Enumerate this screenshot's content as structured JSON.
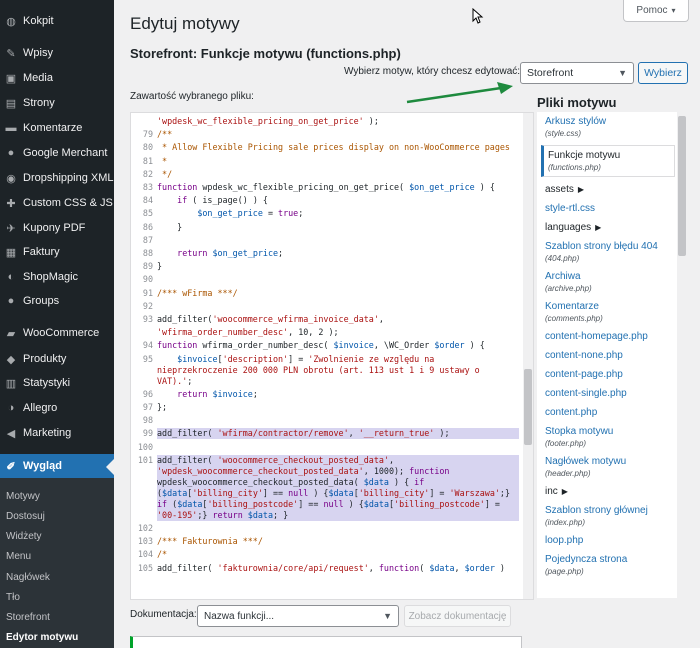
{
  "sidebar": {
    "items": [
      {
        "label": "Kokpit",
        "icon": "dashboard-icon",
        "glyph": "◍"
      },
      {
        "label": "Wpisy",
        "icon": "pin-icon",
        "glyph": "✎"
      },
      {
        "label": "Media",
        "icon": "media-icon",
        "glyph": "▣"
      },
      {
        "label": "Strony",
        "icon": "pages-icon",
        "glyph": "▤"
      },
      {
        "label": "Komentarze",
        "icon": "comments-icon",
        "glyph": "▬"
      },
      {
        "label": "Google Merchant",
        "icon": "google-merchant-icon",
        "glyph": "●"
      },
      {
        "label": "Dropshipping XML",
        "icon": "dropshipping-icon",
        "glyph": "◉"
      },
      {
        "label": "Custom CSS & JS",
        "icon": "custom-css-icon",
        "glyph": "✚"
      },
      {
        "label": "Kupony PDF",
        "icon": "coupon-icon",
        "glyph": "✈"
      },
      {
        "label": "Faktury",
        "icon": "invoices-icon",
        "glyph": "▦"
      },
      {
        "label": "ShopMagic",
        "icon": "shopmagic-icon",
        "glyph": "◐"
      },
      {
        "label": "Groups",
        "icon": "groups-icon",
        "glyph": "●"
      },
      {
        "label": "WooCommerce",
        "icon": "woocommerce-icon",
        "glyph": "▰"
      },
      {
        "label": "Produkty",
        "icon": "products-icon",
        "glyph": "◆"
      },
      {
        "label": "Statystyki",
        "icon": "stats-icon",
        "glyph": "▥"
      },
      {
        "label": "Allegro",
        "icon": "allegro-icon",
        "glyph": "◑"
      },
      {
        "label": "Marketing",
        "icon": "marketing-icon",
        "glyph": "◀"
      },
      {
        "label": "Wygląd",
        "icon": "appearance-icon",
        "glyph": "✐"
      }
    ],
    "submenu": [
      {
        "label": "Motywy"
      },
      {
        "label": "Dostosuj"
      },
      {
        "label": "Widżety"
      },
      {
        "label": "Menu"
      },
      {
        "label": "Nagłówek"
      },
      {
        "label": "Tło"
      },
      {
        "label": "Storefront"
      },
      {
        "label": "Edytor motywu"
      }
    ]
  },
  "header": {
    "title": "Edytuj motywy",
    "help_label": "Pomoc",
    "file_title": "Storefront: Funkcje motywu (functions.php)",
    "select_label": "Wybierz motyw, który chcesz edytować:",
    "selected_theme": "Storefront",
    "select_button": "Wybierz",
    "content_label": "Zawartość wybranego pliku:",
    "files_title": "Pliki motywu"
  },
  "code": {
    "lines": [
      {
        "n": "",
        "tokens": [
          [
            "s",
            "'wpdesk_wc_flexible_pricing_on_get_price'"
          ],
          [
            "d",
            " );"
          ]
        ]
      },
      {
        "n": "79",
        "tokens": [
          [
            "c",
            "/**"
          ]
        ]
      },
      {
        "n": "80",
        "tokens": [
          [
            "c",
            " * Allow Flexible Pricing sale prices display on non-WooCommerce pages"
          ]
        ]
      },
      {
        "n": "81",
        "tokens": [
          [
            "c",
            " *"
          ]
        ]
      },
      {
        "n": "82",
        "tokens": [
          [
            "c",
            " */"
          ]
        ]
      },
      {
        "n": "83",
        "tokens": [
          [
            "k",
            "function"
          ],
          [
            "d",
            " wpdesk_wc_flexible_pricing_on_get_price( "
          ],
          [
            "v",
            "$on_get_price"
          ],
          [
            "d",
            " ) {"
          ]
        ]
      },
      {
        "n": "84",
        "tokens": [
          [
            "d",
            "    "
          ],
          [
            "k",
            "if"
          ],
          [
            "d",
            " ( is_page() ) {"
          ]
        ]
      },
      {
        "n": "85",
        "tokens": [
          [
            "d",
            "        "
          ],
          [
            "v",
            "$on_get_price"
          ],
          [
            "d",
            " = "
          ],
          [
            "k",
            "true"
          ],
          [
            "d",
            ";"
          ]
        ]
      },
      {
        "n": "86",
        "tokens": [
          [
            "d",
            "    }"
          ]
        ]
      },
      {
        "n": "87",
        "tokens": [
          [
            "d",
            ""
          ]
        ]
      },
      {
        "n": "88",
        "tokens": [
          [
            "d",
            "    "
          ],
          [
            "k",
            "return"
          ],
          [
            "d",
            " "
          ],
          [
            "v",
            "$on_get_price"
          ],
          [
            "d",
            ";"
          ]
        ]
      },
      {
        "n": "89",
        "tokens": [
          [
            "d",
            "}"
          ]
        ]
      },
      {
        "n": "90",
        "tokens": [
          [
            "d",
            ""
          ]
        ]
      },
      {
        "n": "91",
        "tokens": [
          [
            "c",
            "/*** wFirma ***/"
          ]
        ]
      },
      {
        "n": "92",
        "tokens": [
          [
            "d",
            ""
          ]
        ]
      },
      {
        "n": "93",
        "tokens": [
          [
            "d",
            "add_filter("
          ],
          [
            "s",
            "'woocommerce_wfirma_invoice_data'"
          ],
          [
            "d",
            ","
          ]
        ]
      },
      {
        "n": "",
        "tokens": [
          [
            "s",
            "'wfirma_order_number_desc'"
          ],
          [
            "d",
            ", 10, 2 );"
          ]
        ]
      },
      {
        "n": "94",
        "tokens": [
          [
            "k",
            "function"
          ],
          [
            "d",
            " wfirma_order_number_desc( "
          ],
          [
            "v",
            "$invoice"
          ],
          [
            "d",
            ", \\WC_Order "
          ],
          [
            "v",
            "$order"
          ],
          [
            "d",
            " ) {"
          ]
        ]
      },
      {
        "n": "95",
        "tokens": [
          [
            "d",
            "    "
          ],
          [
            "v",
            "$invoice"
          ],
          [
            "d",
            "["
          ],
          [
            "s",
            "'description'"
          ],
          [
            "d",
            "] = "
          ],
          [
            "s",
            "'Zwolnienie ze względu na nieprzekroczenie 200 000 PLN obrotu (art. 113 ust 1 i 9 ustawy o VAT).'"
          ],
          [
            "d",
            ";"
          ]
        ]
      },
      {
        "n": "96",
        "tokens": [
          [
            "d",
            "    "
          ],
          [
            "k",
            "return"
          ],
          [
            "d",
            " "
          ],
          [
            "v",
            "$invoice"
          ],
          [
            "d",
            ";"
          ]
        ]
      },
      {
        "n": "97",
        "tokens": [
          [
            "d",
            "};"
          ]
        ]
      },
      {
        "n": "98",
        "tokens": [
          [
            "d",
            ""
          ]
        ]
      },
      {
        "n": "99",
        "hl": true,
        "tokens": [
          [
            "d",
            "add_filter( "
          ],
          [
            "s",
            "'wfirma/contractor/remove'"
          ],
          [
            "d",
            ", "
          ],
          [
            "s",
            "'__return_true'"
          ],
          [
            "d",
            " );"
          ]
        ]
      },
      {
        "n": "100",
        "hl": true,
        "tokens": [
          [
            "d",
            ""
          ]
        ]
      },
      {
        "n": "101",
        "hl": true,
        "tokens": [
          [
            "d",
            "add_filter( "
          ],
          [
            "s",
            "'woocommerce_checkout_posted_data'"
          ],
          [
            "d",
            ", "
          ],
          [
            "s",
            "'wpdesk_woocommerce_checkout_posted_data'"
          ],
          [
            "d",
            ", 1000); "
          ],
          [
            "k",
            "function"
          ],
          [
            "d",
            " wpdesk_woocommerce_checkout_posted_data( "
          ],
          [
            "v",
            "$data"
          ],
          [
            "d",
            " ) { "
          ],
          [
            "k",
            "if"
          ],
          [
            "d",
            " ("
          ],
          [
            "v",
            "$data"
          ],
          [
            "d",
            "["
          ],
          [
            "s",
            "'billing_city'"
          ],
          [
            "d",
            "] == "
          ],
          [
            "k",
            "null"
          ],
          [
            "d",
            " ) {"
          ],
          [
            "v",
            "$data"
          ],
          [
            "d",
            "["
          ],
          [
            "s",
            "'billing_city'"
          ],
          [
            "d",
            "] = "
          ],
          [
            "s",
            "'Warszawa'"
          ],
          [
            "d",
            ";} "
          ],
          [
            "k",
            "if"
          ],
          [
            "d",
            " ("
          ],
          [
            "v",
            "$data"
          ],
          [
            "d",
            "["
          ],
          [
            "s",
            "'billing_postcode'"
          ],
          [
            "d",
            "] == "
          ],
          [
            "k",
            "null"
          ],
          [
            "d",
            " ) {"
          ],
          [
            "v",
            "$data"
          ],
          [
            "d",
            "["
          ],
          [
            "s",
            "'billing_postcode'"
          ],
          [
            "d",
            "] = "
          ],
          [
            "s",
            "'00-195'"
          ],
          [
            "d",
            ";} "
          ],
          [
            "k",
            "return"
          ],
          [
            "d",
            " "
          ],
          [
            "v",
            "$data"
          ],
          [
            "d",
            "; }"
          ]
        ]
      },
      {
        "n": "102",
        "tokens": [
          [
            "d",
            ""
          ]
        ]
      },
      {
        "n": "103",
        "tokens": [
          [
            "c",
            "/*** Fakturownia ***/"
          ]
        ]
      },
      {
        "n": "104",
        "tokens": [
          [
            "c",
            "/*"
          ]
        ]
      },
      {
        "n": "105",
        "tokens": [
          [
            "d",
            "add_filter( "
          ],
          [
            "s",
            "'fakturownia/core/api/request'"
          ],
          [
            "d",
            ", "
          ],
          [
            "k",
            "function"
          ],
          [
            "d",
            "( "
          ],
          [
            "v",
            "$data"
          ],
          [
            "d",
            ", "
          ],
          [
            "v",
            "$order"
          ],
          [
            "d",
            " )"
          ]
        ]
      }
    ]
  },
  "files": [
    {
      "name": "Arkusz stylów",
      "sub": "(style.css)"
    },
    {
      "name": "Funkcje motywu",
      "sub": "(functions.php)",
      "current": true
    },
    {
      "name": "assets",
      "folder": true
    },
    {
      "name": "style-rtl.css"
    },
    {
      "name": "languages",
      "folder": true
    },
    {
      "name": "Szablon strony błędu 404",
      "sub": "(404.php)"
    },
    {
      "name": "Archiwa",
      "sub": "(archive.php)"
    },
    {
      "name": "Komentarze",
      "sub": "(comments.php)"
    },
    {
      "name": "content-homepage.php"
    },
    {
      "name": "content-none.php"
    },
    {
      "name": "content-page.php"
    },
    {
      "name": "content-single.php"
    },
    {
      "name": "content.php"
    },
    {
      "name": "Stopka motywu",
      "sub": "(footer.php)"
    },
    {
      "name": "Nagłówek motywu",
      "sub": "(header.php)"
    },
    {
      "name": "inc",
      "folder": true
    },
    {
      "name": "Szablon strony głównej",
      "sub": "(index.php)"
    },
    {
      "name": "loop.php"
    },
    {
      "name": "Pojedyncza strona",
      "sub": "(page.php)"
    }
  ],
  "footer": {
    "doc_label": "Dokumentacja:",
    "doc_placeholder": "Nazwa funkcji...",
    "doc_button": "Zobacz dokumentację"
  },
  "colors": {
    "sidebar_bg": "#1d2327",
    "accent": "#2271b1",
    "highlight": "#d7d4f0",
    "arrow_green": "#1e8a3e"
  }
}
